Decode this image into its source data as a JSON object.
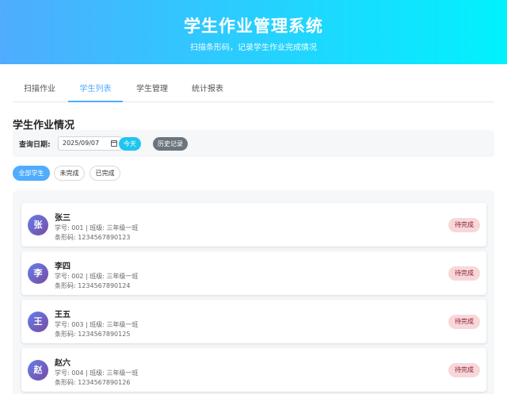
{
  "header": {
    "title": "学生作业管理系统",
    "subtitle": "扫描条形码，记录学生作业完成情况"
  },
  "tabs": [
    {
      "label": "扫描作业"
    },
    {
      "label": "学生列表"
    },
    {
      "label": "学生管理"
    },
    {
      "label": "统计报表"
    }
  ],
  "section_title": "学生作业情况",
  "filter": {
    "label": "查询日期:",
    "date_value": "2025/09/07",
    "today_label": "今天",
    "history_label": "历史记录"
  },
  "chips": [
    {
      "label": "全部学生"
    },
    {
      "label": "未完成"
    },
    {
      "label": "已完成"
    }
  ],
  "students": [
    {
      "avatar": "张",
      "name": "张三",
      "info": "学号: 001 | 班级: 三年级一班",
      "barcode": "条形码: 1234567890123",
      "status": "待完成"
    },
    {
      "avatar": "李",
      "name": "李四",
      "info": "学号: 002 | 班级: 三年级一班",
      "barcode": "条形码: 1234567890124",
      "status": "待完成"
    },
    {
      "avatar": "王",
      "name": "王五",
      "info": "学号: 003 | 班级: 三年级一班",
      "barcode": "条形码: 1234567890125",
      "status": "待完成"
    },
    {
      "avatar": "赵",
      "name": "赵六",
      "info": "学号: 004 | 班级: 三年级一班",
      "barcode": "条形码: 1234567890126",
      "status": "待完成"
    }
  ],
  "colors": {
    "header_start": "#4facfe",
    "header_end": "#00f2fe",
    "active_tab": "#4facfe",
    "today_button": "#20c4ef",
    "history_button": "#6c757d",
    "status_pending_bg": "#f8d7da",
    "status_pending_text": "#842029"
  }
}
